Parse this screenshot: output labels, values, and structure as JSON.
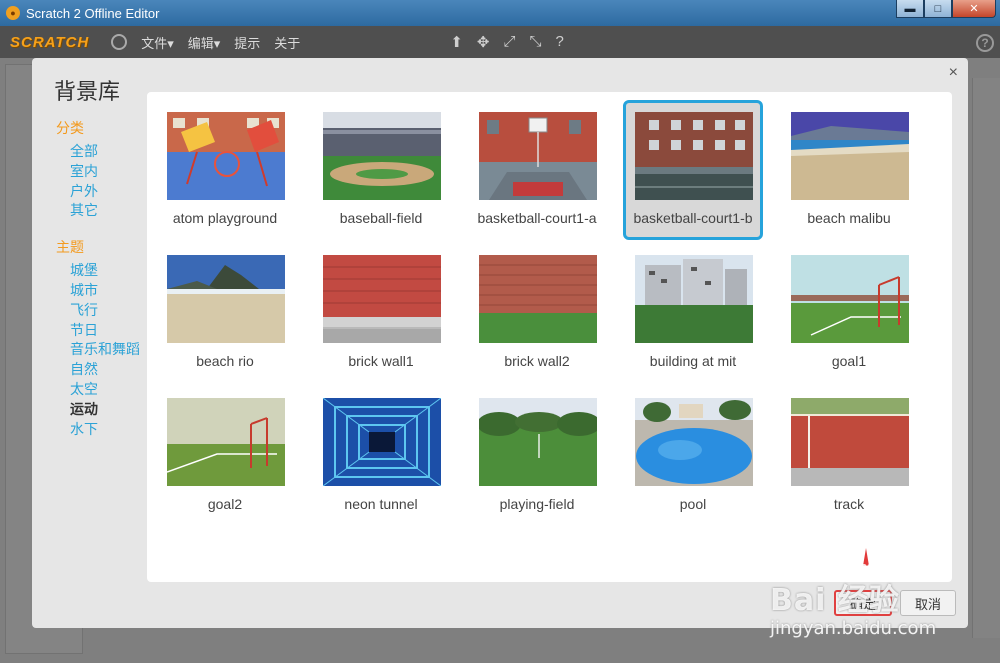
{
  "window": {
    "title": "Scratch 2 Offline Editor",
    "controls": {
      "minimize": "▬",
      "maximize": "□",
      "close": "✕"
    }
  },
  "menubar": {
    "logo": "SCRATCH",
    "items": [
      "文件▾",
      "编辑▾",
      "提示",
      "关于"
    ],
    "tool_icons": [
      "⬆",
      "✥",
      "⤢",
      "⤡",
      "?"
    ]
  },
  "dialog": {
    "title": "背景库",
    "close": "×",
    "categories_heading": "分类",
    "categories": [
      "全部",
      "室内",
      "户外",
      "其它"
    ],
    "themes_heading": "主题",
    "themes": [
      "城堡",
      "城市",
      "飞行",
      "节日",
      "音乐和舞蹈",
      "自然",
      "太空",
      "运动",
      "水下"
    ],
    "selected_theme": "运动",
    "ok_label": "确定",
    "cancel_label": "取消"
  },
  "backdrops": [
    {
      "name": "atom playground",
      "selected": false
    },
    {
      "name": "baseball-field",
      "selected": false
    },
    {
      "name": "basketball-court1-a",
      "selected": false
    },
    {
      "name": "basketball-court1-b",
      "selected": true
    },
    {
      "name": "beach malibu",
      "selected": false
    },
    {
      "name": "beach rio",
      "selected": false
    },
    {
      "name": "brick wall1",
      "selected": false
    },
    {
      "name": "brick wall2",
      "selected": false
    },
    {
      "name": "building at mit",
      "selected": false
    },
    {
      "name": "goal1",
      "selected": false
    },
    {
      "name": "goal2",
      "selected": false
    },
    {
      "name": "neon tunnel",
      "selected": false
    },
    {
      "name": "playing-field",
      "selected": false
    },
    {
      "name": "pool",
      "selected": false
    },
    {
      "name": "track",
      "selected": false
    }
  ],
  "watermark": {
    "brand": "Bai 经验",
    "url": "jingyan.baidu.com"
  }
}
